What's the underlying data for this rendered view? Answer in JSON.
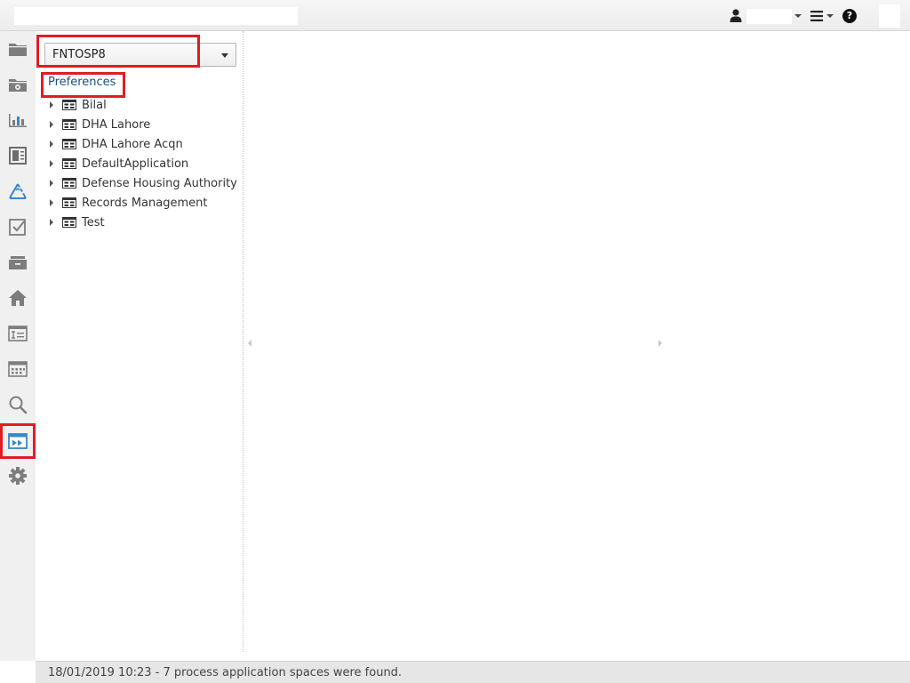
{
  "topbar": {
    "user_icon": "user-icon",
    "menu_icon": "hamburger-menu-icon",
    "help_icon": "help-icon",
    "help_glyph": "?"
  },
  "rail": {
    "items": [
      {
        "icon": "folder-icon"
      },
      {
        "icon": "folder-gear-icon"
      },
      {
        "icon": "bar-chart-icon"
      },
      {
        "icon": "document-panel-icon"
      },
      {
        "icon": "recycle-icon"
      },
      {
        "icon": "checkbox-task-icon"
      },
      {
        "icon": "inbox-tray-icon"
      },
      {
        "icon": "home-icon"
      },
      {
        "icon": "form-text-icon"
      },
      {
        "icon": "calendar-grid-icon"
      },
      {
        "icon": "search-icon"
      },
      {
        "icon": "fast-forward-window-icon",
        "active": true
      },
      {
        "icon": "gear-icon"
      }
    ]
  },
  "tree": {
    "connection_select": {
      "value": "FNTOSP8"
    },
    "preferences_link": "Preferences",
    "items": [
      {
        "label": "Bilal"
      },
      {
        "label": "DHA Lahore"
      },
      {
        "label": "DHA Lahore Acqn"
      },
      {
        "label": "DefaultApplication"
      },
      {
        "label": "Defense Housing Authority"
      },
      {
        "label": "Records Management"
      },
      {
        "label": "Test"
      }
    ]
  },
  "status": {
    "text": "18/01/2019 10:23 - 7 process application spaces were found."
  },
  "colors": {
    "highlight": "#e01c24",
    "icon_gray": "#7d7d7d",
    "icon_blue": "#3a86c8",
    "link": "#1a4f86"
  }
}
